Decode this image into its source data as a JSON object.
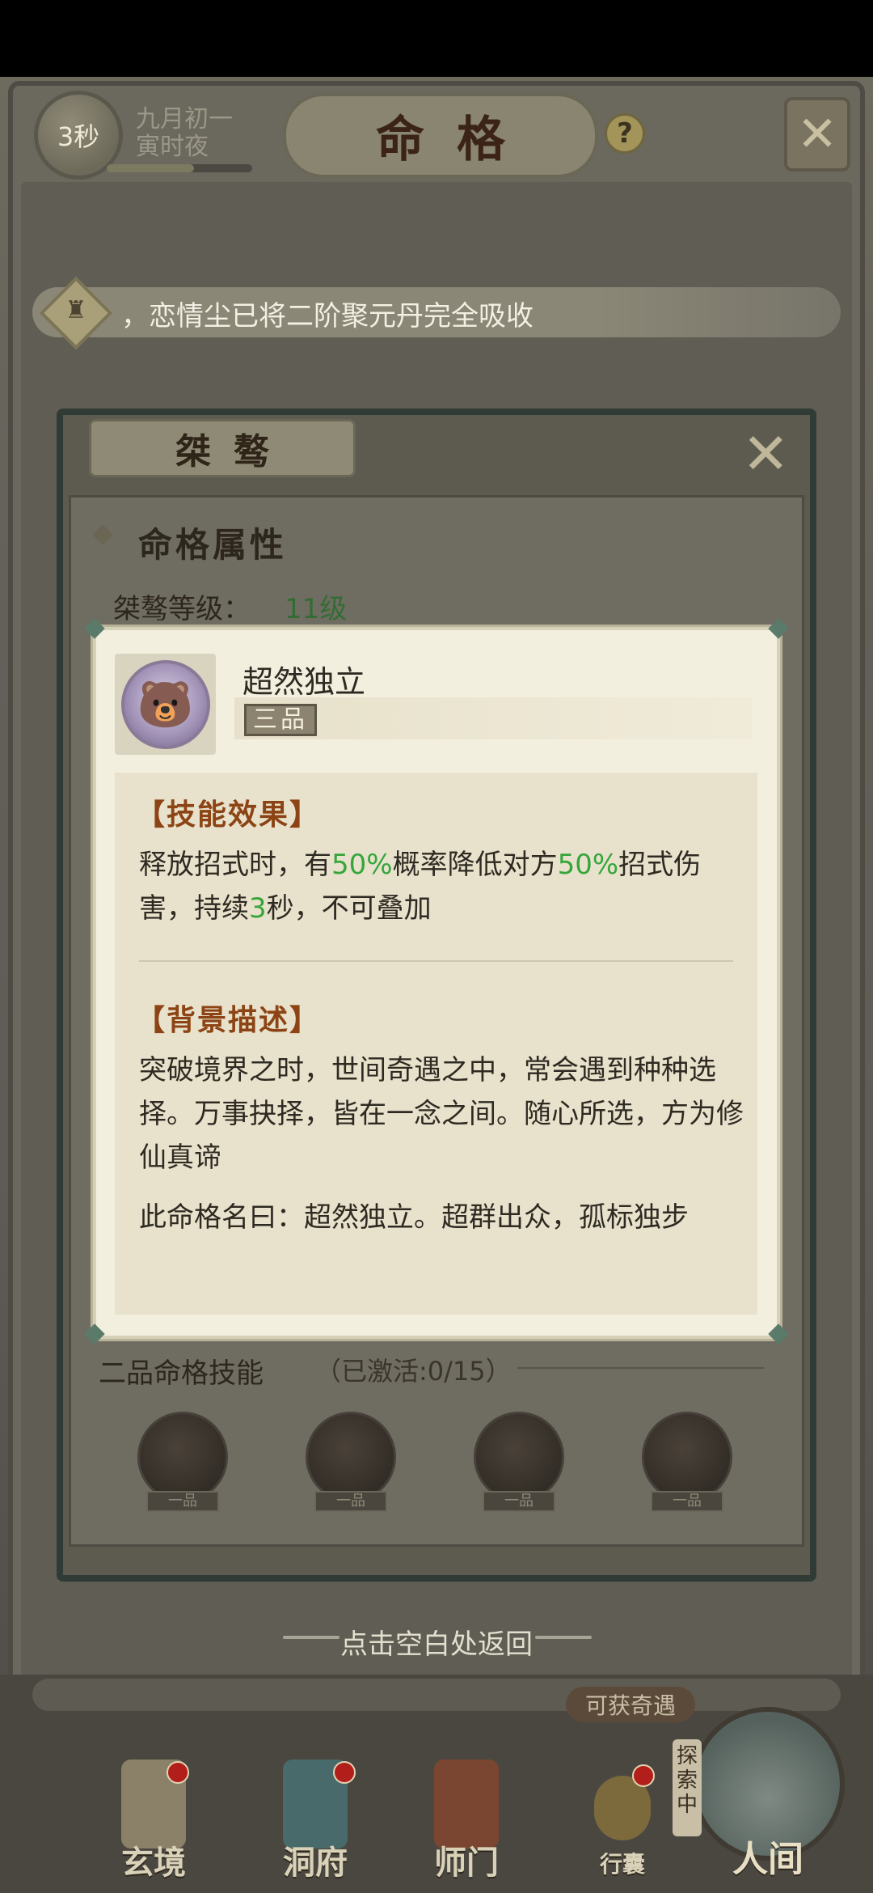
{
  "header": {
    "timer": "3秒",
    "date_line1": "九月初一",
    "date_line2": "寅时夜",
    "day_progress": 0.6,
    "title": "命格",
    "help": "?"
  },
  "notice": {
    "text": "，恋情尘已将二阶聚元丹完全吸收"
  },
  "back_dialog": {
    "title": "桀骜",
    "attr_title": "命格属性",
    "level_label": "桀骜等级：",
    "level_value": "11级",
    "skill_label": "二品命格技能",
    "skill_count": "（已激活:0/15）",
    "skill_tags": [
      "一品",
      "一品",
      "一品",
      "一品"
    ]
  },
  "popup": {
    "item_name": "超然独立",
    "grade": "三品",
    "effect_title": "【技能效果】",
    "effect_p1": "释放招式时，有",
    "effect_v1": "50%",
    "effect_p2": "概率降低对方",
    "effect_v2": "50%",
    "effect_p3": "招式伤害，持续",
    "effect_v3": "3",
    "effect_p4": "秒，不可叠加",
    "background_title": "【背景描述】",
    "background_text": "突破境界之时，世间奇遇之中，常会遇到种种选择。万事抉择，皆在一念之间。随心所选，方为修仙真谛",
    "name_text": "此命格名曰：超然独立。超群出众，孤标独步"
  },
  "tap_to_return": "点击空白处返回",
  "bottom_nav": {
    "explore_pill": "可获奇遇",
    "items": [
      {
        "label": "玄境"
      },
      {
        "label": "洞府"
      },
      {
        "label": "师门"
      },
      {
        "label": "行囊"
      }
    ],
    "explore_tag": "探索中",
    "world_label": "人间"
  },
  "colors": {
    "accent_green": "#36a63b",
    "section_title": "#8c4415",
    "popup_bg": "#f3efdf"
  }
}
